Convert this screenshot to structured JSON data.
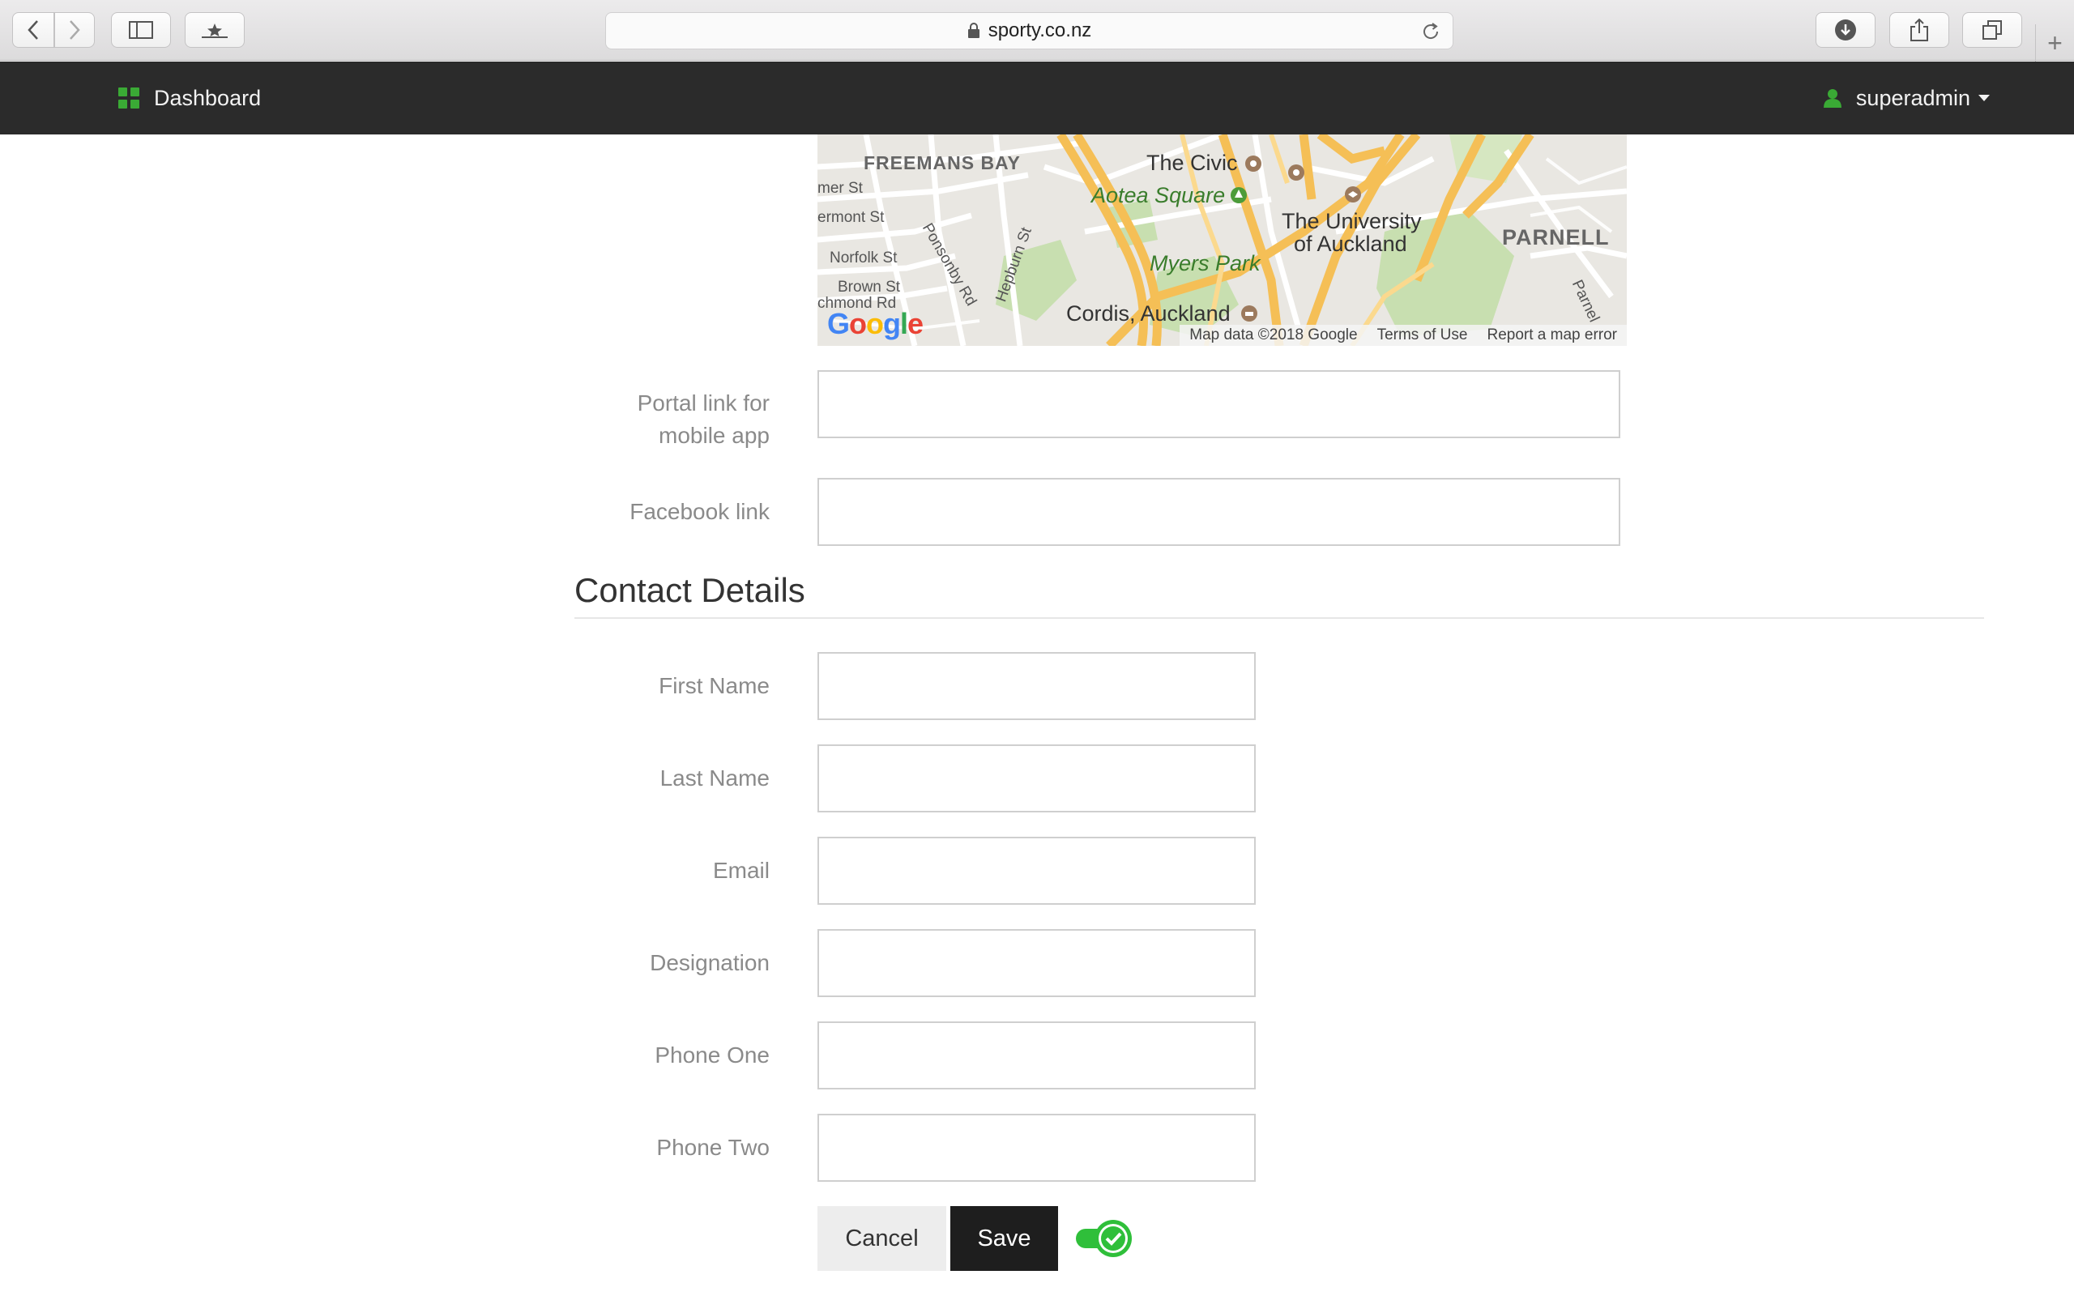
{
  "browser": {
    "url": "sporty.co.nz",
    "colors": {
      "chrome": "#dcdbdc"
    }
  },
  "navbar": {
    "brand_label": "Dashboard",
    "user_label": "superadmin",
    "colors": {
      "background": "#2b2b2b",
      "accent": "#3aaa35"
    }
  },
  "map": {
    "labels": {
      "freemans_bay": "FREEMANS BAY",
      "the_civic": "The Civic",
      "aotea_square": "Aotea Square",
      "university": "The University",
      "university2": "of Auckland",
      "myers_park": "Myers Park",
      "parnell": "PARNELL",
      "cordis": "Cordis, Auckland",
      "mer_st": "mer St",
      "ermont_st": "ermont St",
      "norfolk_st": "Norfolk St",
      "brown_st": "Brown St",
      "richmond_rd": "chmond Rd",
      "ponsonby_rd": "Ponsonby Rd",
      "hepburn_st": "Hepburn St",
      "parnell_rd": "Parnel"
    },
    "google": "Google",
    "footer": {
      "map_data": "Map data ©2018 Google",
      "terms": "Terms of Use",
      "report": "Report a map error"
    }
  },
  "form": {
    "portal_link_label": "Portal link for mobile app",
    "facebook_link_label": "Facebook link",
    "portal_link_value": "",
    "facebook_link_value": ""
  },
  "contact": {
    "title": "Contact Details",
    "fields": [
      {
        "label": "First Name",
        "value": ""
      },
      {
        "label": "Last Name",
        "value": ""
      },
      {
        "label": "Email",
        "value": ""
      },
      {
        "label": "Designation",
        "value": ""
      },
      {
        "label": "Phone One",
        "value": ""
      },
      {
        "label": "Phone Two",
        "value": ""
      }
    ]
  },
  "actions": {
    "cancel_label": "Cancel",
    "save_label": "Save",
    "toggle_on": true,
    "toggle_color": "#2fbf3a"
  }
}
